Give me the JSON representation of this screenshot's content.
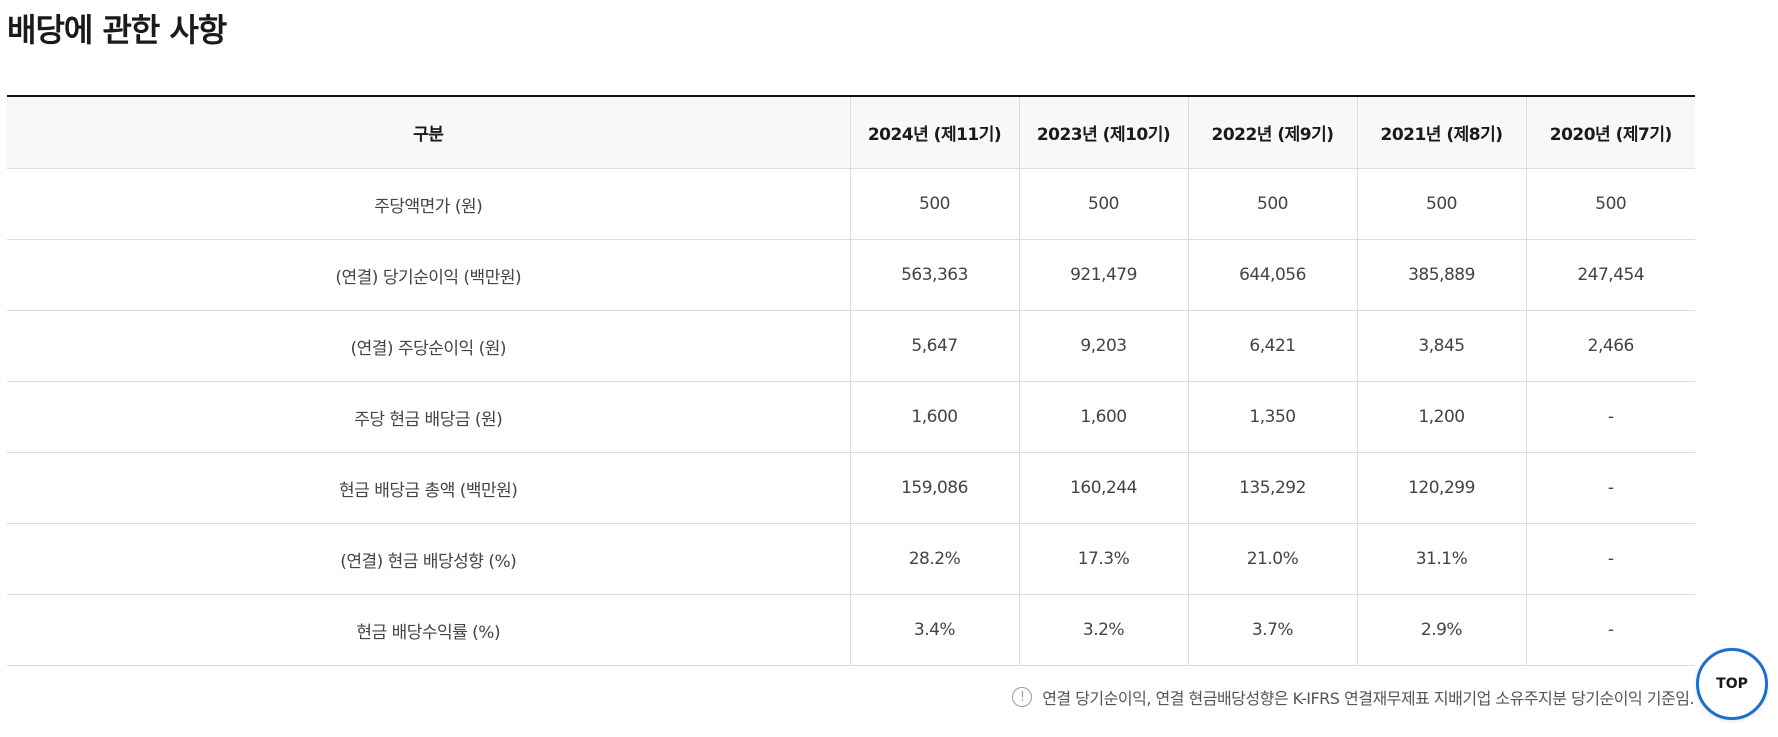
{
  "page": {
    "title": "배당에 관한 사항"
  },
  "table": {
    "headers": [
      "구분",
      "2024년 (제11기)",
      "2023년 (제10기)",
      "2022년 (제9기)",
      "2021년 (제8기)",
      "2020년 (제7기)"
    ],
    "rows": [
      {
        "label": "주당액면가 (원)",
        "values": [
          "500",
          "500",
          "500",
          "500",
          "500"
        ]
      },
      {
        "label": "(연결) 당기순이익 (백만원)",
        "values": [
          "563,363",
          "921,479",
          "644,056",
          "385,889",
          "247,454"
        ]
      },
      {
        "label": "(연결) 주당순이익 (원)",
        "values": [
          "5,647",
          "9,203",
          "6,421",
          "3,845",
          "2,466"
        ]
      },
      {
        "label": "주당 현금 배당금 (원)",
        "values": [
          "1,600",
          "1,600",
          "1,350",
          "1,200",
          "-"
        ]
      },
      {
        "label": "현금 배당금 총액 (백만원)",
        "values": [
          "159,086",
          "160,244",
          "135,292",
          "120,299",
          "-"
        ]
      },
      {
        "label": "(연결) 현금 배당성향 (%)",
        "values": [
          "28.2%",
          "17.3%",
          "21.0%",
          "31.1%",
          "-"
        ]
      },
      {
        "label": "현금 배당수익률 (%)",
        "values": [
          "3.4%",
          "3.2%",
          "3.7%",
          "2.9%",
          "-"
        ]
      }
    ]
  },
  "note": {
    "icon": "info-icon",
    "glyph": "!",
    "text": "연결 당기순이익, 연결 현금배당성향은 K-IFRS 연결재무제표 지배기업 소유주지분 당기순이익 기준임."
  },
  "top_button": {
    "label": "TOP",
    "accent_color": "#1e6fc8"
  }
}
